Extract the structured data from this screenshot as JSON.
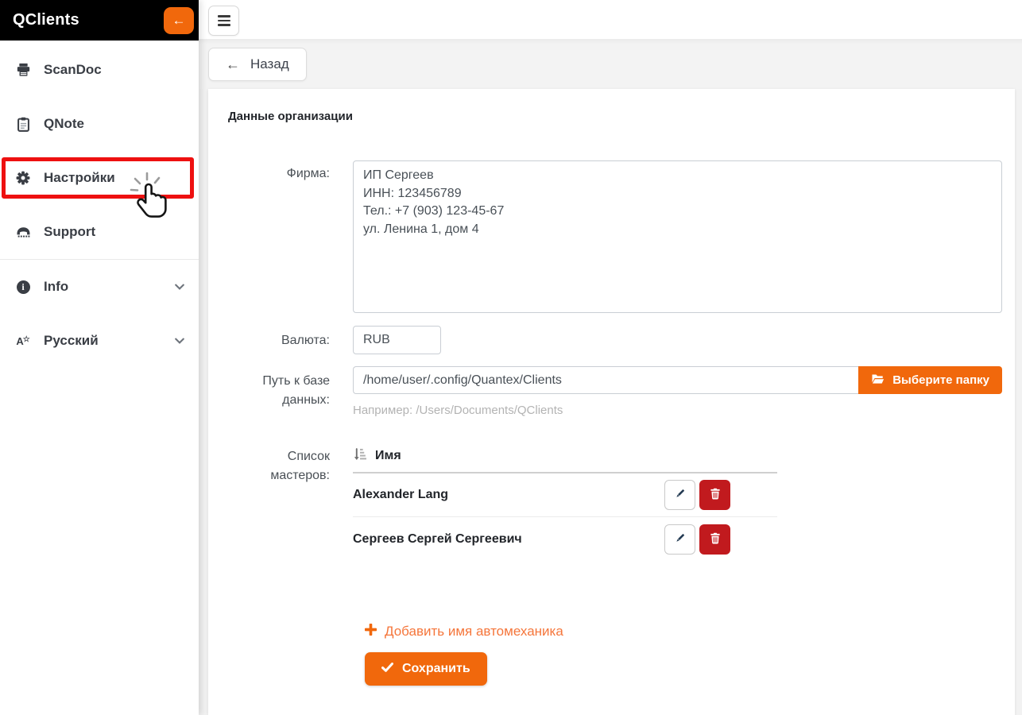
{
  "colors": {
    "accent": "#f1680c",
    "danger": "#c11a1e",
    "annotation": "#ee1010"
  },
  "app": {
    "title": "QClients",
    "collapse_icon": "arrow-left-icon"
  },
  "sidebar": {
    "items": [
      {
        "label": "ScanDoc",
        "icon": "printer-icon"
      },
      {
        "label": "QNote",
        "icon": "clipboard-icon"
      },
      {
        "label": "Настройки",
        "icon": "gear-icon",
        "highlighted": true
      },
      {
        "label": "Support",
        "icon": "phone-icon"
      },
      {
        "label": "Info",
        "icon": "info-icon",
        "chevron": "chevron-down-icon"
      },
      {
        "label": "Русский",
        "icon": "language-icon",
        "chevron": "chevron-down-icon"
      }
    ]
  },
  "topbar": {
    "menu_icon": "hamburger-icon"
  },
  "back_button": {
    "label": "Назад",
    "icon": "arrow-left-icon"
  },
  "form": {
    "section_title": "Данные организации",
    "company": {
      "label": "Фирма:",
      "value": "ИП Сергеев\nИНН: 123456789\nТел.: +7 (903) 123-45-67\nул. Ленина 1, дом 4"
    },
    "currency": {
      "label": "Валюта:",
      "value": "RUB"
    },
    "db_path": {
      "label": "Путь к базе данных:",
      "value": "/home/user/.config/Quantex/Clients",
      "button_label": "Выберите папку",
      "button_icon": "folder-open-icon",
      "hint": "Например: /Users/Documents/QClients"
    },
    "masters": {
      "label": "Список мастеров:",
      "column_header": "Имя",
      "sort_icon": "sort-amount-icon",
      "rows": [
        {
          "name": "Alexander Lang"
        },
        {
          "name": "Сергеев Сергей Сергеевич"
        }
      ],
      "row_actions": {
        "edit_icon": "pencil-icon",
        "delete_icon": "trash-icon"
      },
      "add_label": "Добавить имя автомеханика",
      "add_icon": "plus-icon"
    },
    "save": {
      "label": "Сохранить",
      "icon": "check-icon"
    }
  }
}
